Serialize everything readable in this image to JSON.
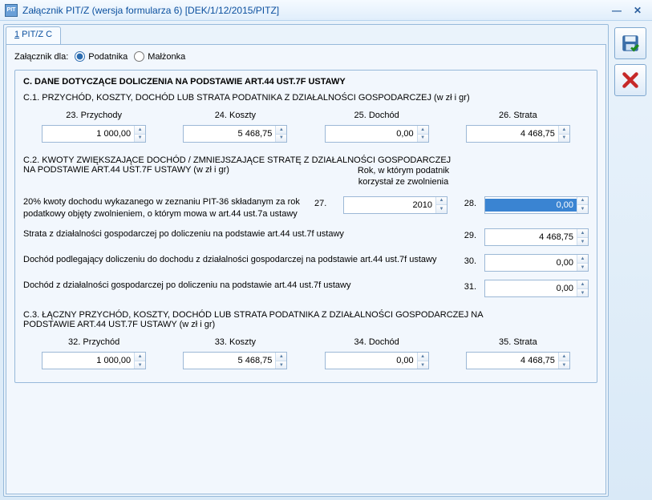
{
  "window": {
    "title": "Załącznik PIT/Z (wersja formularza 6) [DEK/1/12/2015/PITZ]",
    "icon_label": "PIT/Z"
  },
  "tab": {
    "number": "1",
    "label": " PIT/Z C"
  },
  "top": {
    "label": "Załącznik dla:",
    "option1": "Podatnika",
    "option2": "Małżonka"
  },
  "sectionC": {
    "heading": "C. DANE DOTYCZĄCE DOLICZENIA NA PODSTAWIE ART.44 UST.7F USTAWY",
    "c1_heading": "C.1. PRZYCHÓD, KOSZTY, DOCHÓD LUB STRATA PODATNIKA Z DZIAŁALNOŚCI GOSPODARCZEJ (w zł i gr)",
    "c1": {
      "l23": "23. Przychody",
      "v23": "1 000,00",
      "l24": "24. Koszty",
      "v24": "5 468,75",
      "l25": "25. Dochód",
      "v25": "0,00",
      "l26": "26. Strata",
      "v26": "4 468,75"
    },
    "c2_heading1": "C.2. KWOTY ZWIĘKSZAJĄCE DOCHÓD / ZMNIEJSZAJĄCE STRATĘ Z DZIAŁALNOŚCI GOSPODARCZEJ",
    "c2_heading2": "NA PODSTAWIE ART.44 UST.7F USTAWY (w zł i gr)",
    "year_header": "Rok, w którym podatnik korzystał ze zwolnienia",
    "rows": {
      "r1": {
        "text": "20% kwoty dochodu wykazanego w zeznaniu PIT-36 składanym za rok podatkowy objęty zwolnieniem, o którym mowa w art.44 ust.7a ustawy",
        "n1": "27.",
        "v1": "2010",
        "n2": "28.",
        "v2": "0,00"
      },
      "r2": {
        "text": "Strata z działalności gospodarczej po doliczeniu na podstawie art.44 ust.7f ustawy",
        "n": "29.",
        "v": "4 468,75"
      },
      "r3": {
        "text": "Dochód podlegający doliczeniu do dochodu z działalności gospodarczej na podstawie art.44 ust.7f ustawy",
        "n": "30.",
        "v": "0,00"
      },
      "r4": {
        "text": "Dochód z działalności gospodarczej po doliczeniu na podstawie art.44 ust.7f ustawy",
        "n": "31.",
        "v": "0,00"
      }
    },
    "c3_heading1": "C.3. ŁĄCZNY PRZYCHÓD, KOSZTY, DOCHÓD LUB STRATA PODATNIKA Z DZIAŁALNOŚCI GOSPODARCZEJ NA",
    "c3_heading2": "PODSTAWIE ART.44 UST.7F USTAWY (w zł i gr)",
    "c3": {
      "l32": "32. Przychód",
      "v32": "1 000,00",
      "l33": "33. Koszty",
      "v33": "5 468,75",
      "l34": "34. Dochód",
      "v34": "0,00",
      "l35": "35. Strata",
      "v35": "4 468,75"
    }
  }
}
